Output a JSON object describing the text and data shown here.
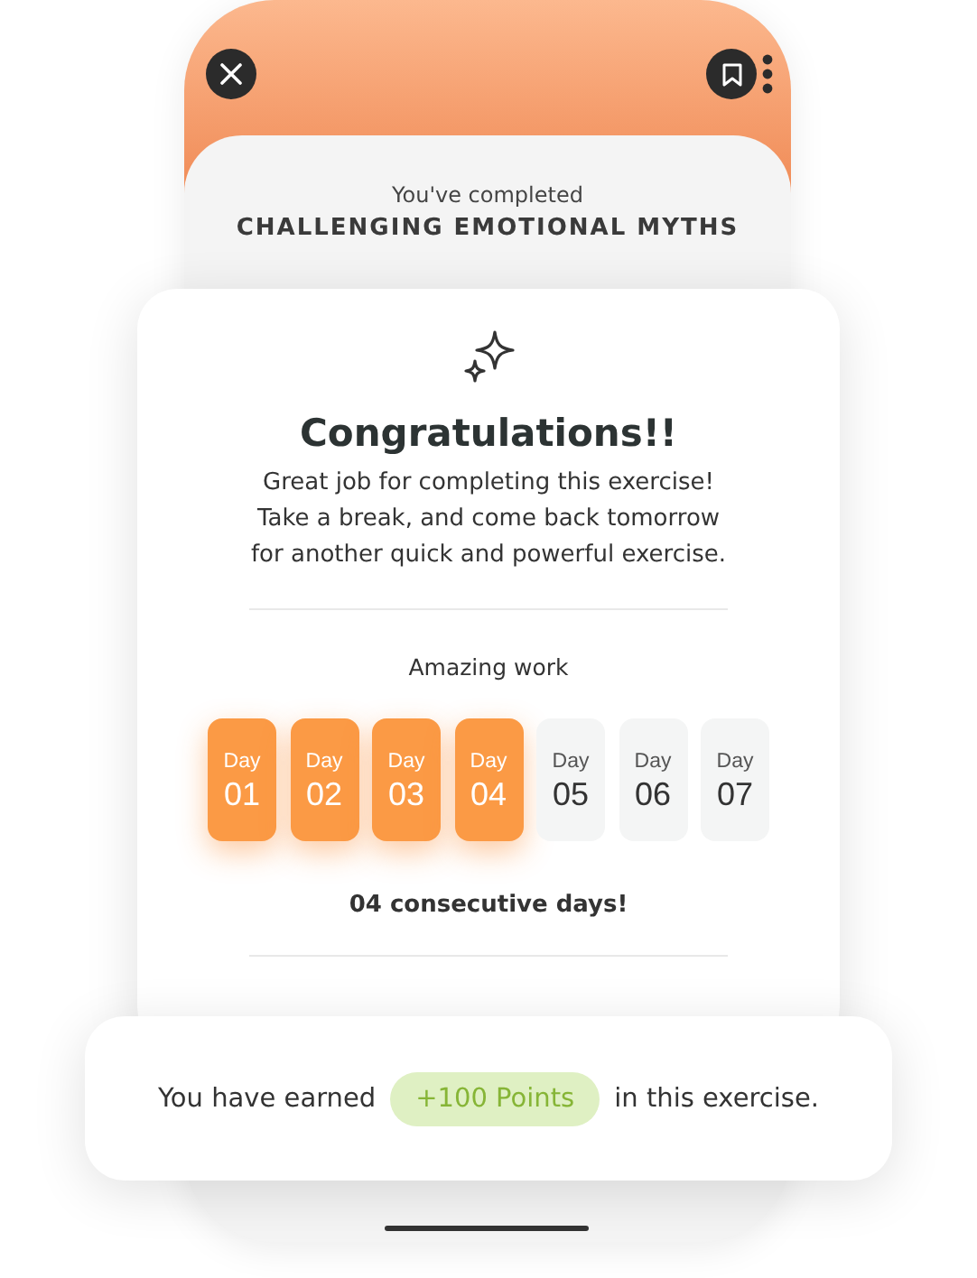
{
  "header": {
    "subtitle": "You've completed",
    "title": "CHALLENGING EMOTIONAL MYTHS"
  },
  "congrats": {
    "title": "Congratulations!!",
    "message": "Great job for completing this exercise! Take a break, and come back tomorrow for another quick and powerful exercise.",
    "streak_heading": "Amazing work",
    "days": [
      {
        "label": "Day",
        "number": "01",
        "done": true
      },
      {
        "label": "Day",
        "number": "02",
        "done": true
      },
      {
        "label": "Day",
        "number": "03",
        "done": true
      },
      {
        "label": "Day",
        "number": "04",
        "done": true
      },
      {
        "label": "Day",
        "number": "05",
        "done": false
      },
      {
        "label": "Day",
        "number": "06",
        "done": false
      },
      {
        "label": "Day",
        "number": "07",
        "done": false
      }
    ],
    "streak_summary": "04 consecutive days!"
  },
  "reward": {
    "before": "You have earned",
    "points": "+100 Points",
    "after": "in this exercise."
  }
}
